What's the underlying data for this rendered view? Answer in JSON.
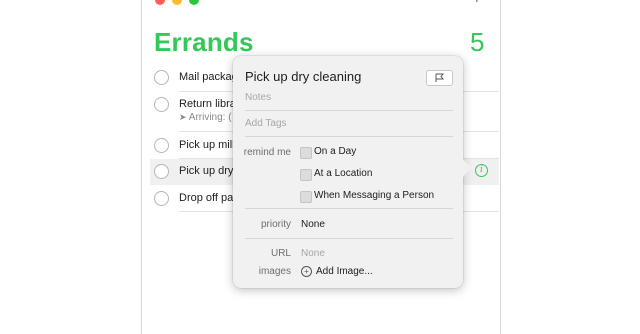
{
  "window": {
    "traffic_lights": [
      "#ff5f57",
      "#febc2e",
      "#28c840"
    ],
    "add_icon": "+"
  },
  "list": {
    "title": "Errands",
    "count": "5",
    "accent": "#34c759",
    "items": [
      {
        "title": "Mail packag",
        "subtitle": ""
      },
      {
        "title": "Return libra",
        "subtitle": "Arriving: ("
      },
      {
        "title": "Pick up milk",
        "subtitle": ""
      },
      {
        "title": "Pick up dry",
        "subtitle": ""
      },
      {
        "title": "Drop off pap",
        "subtitle": ""
      }
    ]
  },
  "popover": {
    "title": "Pick up dry cleaning",
    "notes_placeholder": "Notes",
    "tags_placeholder": "Add Tags",
    "remind_me_label": "remind me",
    "remind_options": [
      "On a Day",
      "At a Location",
      "When Messaging a Person"
    ],
    "priority_label": "priority",
    "priority_value": "None",
    "url_label": "URL",
    "url_value": "None",
    "images_label": "images",
    "add_image_label": "Add Image..."
  }
}
